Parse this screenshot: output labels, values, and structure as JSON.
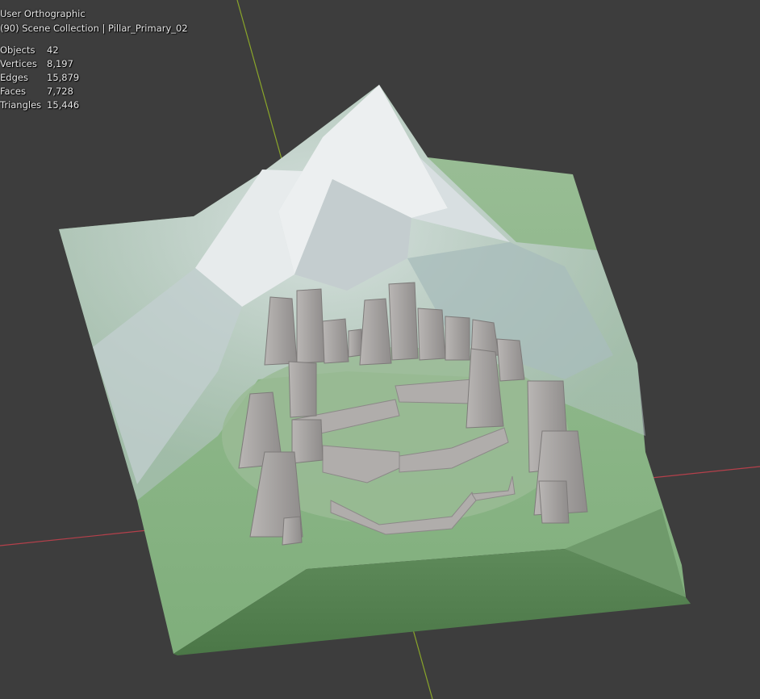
{
  "viewport": {
    "view_name": "User Orthographic",
    "collection_info": "(90) Scene Collection | Pillar_Primary_02",
    "stats": [
      {
        "label": "Objects",
        "value": "42"
      },
      {
        "label": "Vertices",
        "value": "8,197"
      },
      {
        "label": "Edges",
        "value": "15,879"
      },
      {
        "label": "Faces",
        "value": "7,728"
      },
      {
        "label": "Triangles",
        "value": "15,446"
      }
    ],
    "colors": {
      "background": "#3d3d3d",
      "x_axis": "#b5404b",
      "y_axis": "#8aa62a",
      "terrain": "#8fb58c",
      "terrain_dark": "#4f7a4c",
      "mountain": "#d6dcde",
      "stone": "#a9a6a4"
    }
  }
}
